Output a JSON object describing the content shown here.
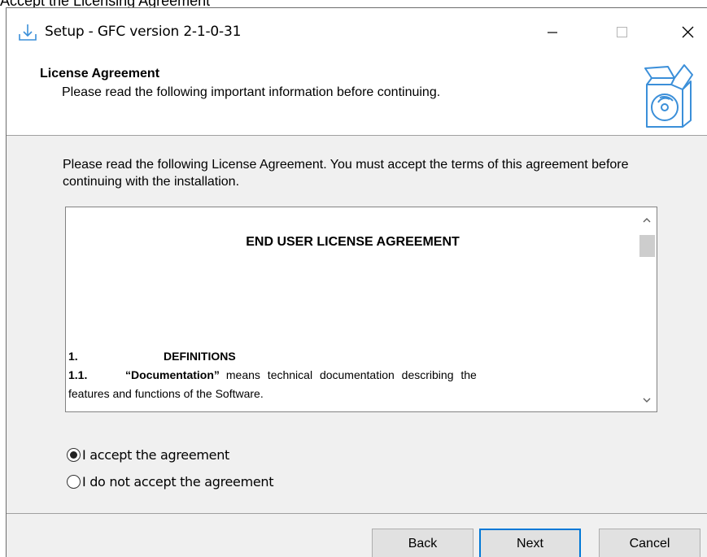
{
  "caption": "Accept the Licensing Agreement",
  "window": {
    "title": "Setup - GFC version 2-1-0-31",
    "icons": {
      "app": "setup-download-icon",
      "minimize": "minimize-icon",
      "maximize": "maximize-icon",
      "close": "close-icon"
    }
  },
  "header": {
    "title": "License Agreement",
    "subtitle": "Please read the following important information before continuing.",
    "icon": "software-box-disc-icon"
  },
  "intro": "Please read the following License Agreement. You must accept the terms of this agreement before continuing with the installation.",
  "license": {
    "heading": "END USER LICENSE AGREEMENT",
    "section_number": "1.",
    "section_title": "DEFINITIONS",
    "clause_number": "1.1.",
    "clause_term": "“Documentation”",
    "clause_text_1": "means technical documentation describing the",
    "clause_text_2": "features and functions of the Software."
  },
  "options": {
    "accept": {
      "label": "I accept the agreement",
      "selected": true
    },
    "decline": {
      "label": "I do not accept the agreement",
      "selected": false
    }
  },
  "buttons": {
    "back": "Back",
    "next": "Next",
    "cancel": "Cancel"
  },
  "colors": {
    "focus_border": "#0078d7",
    "icon_blue": "#3b8fd9",
    "dialog_bg": "#f0f0f0"
  }
}
